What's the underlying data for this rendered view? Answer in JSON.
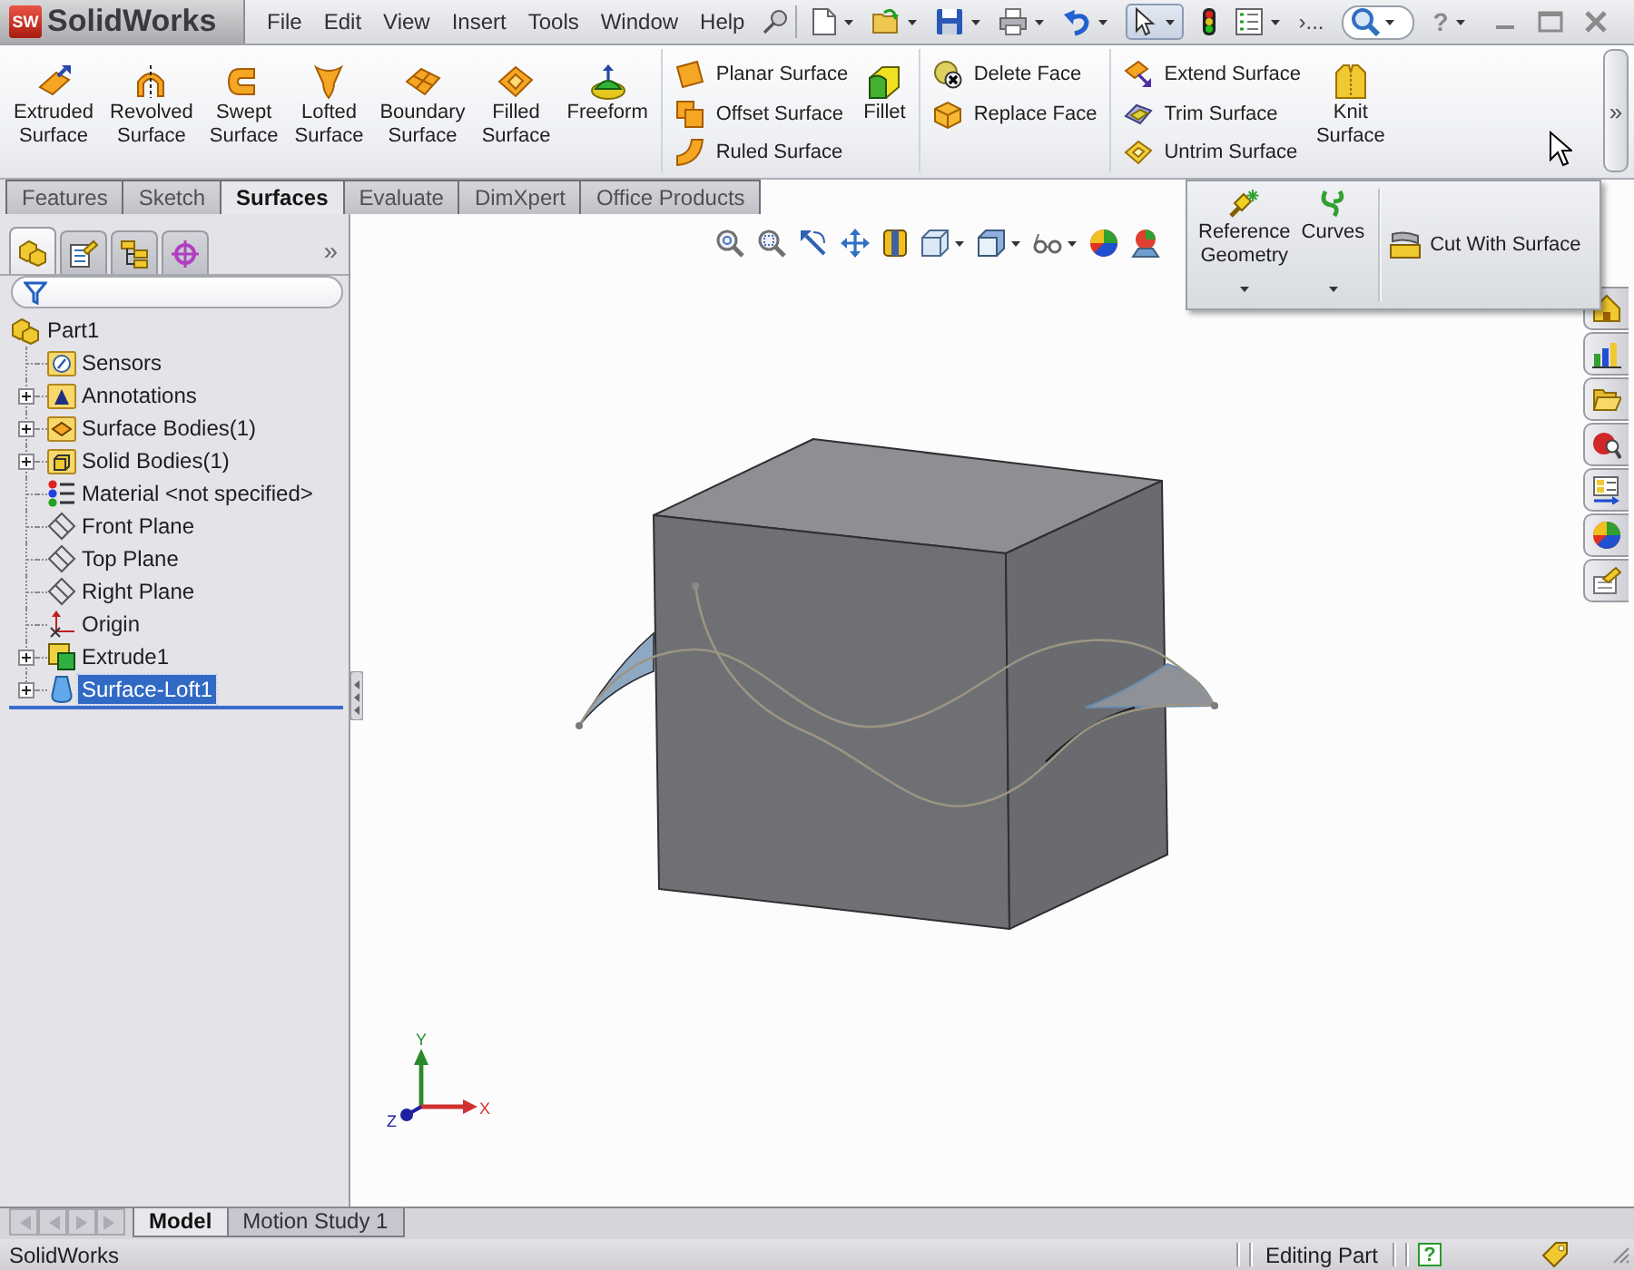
{
  "title_bar": {
    "logo_mark": "SW",
    "logo_text": "SolidWorks",
    "menu": [
      "File",
      "Edit",
      "View",
      "Insert",
      "Tools",
      "Window",
      "Help"
    ],
    "select_active": true,
    "overflow": "›...",
    "help": "?"
  },
  "ribbon": {
    "sections": [
      [
        {
          "kind": "large",
          "label": "Extruded Surface"
        },
        {
          "kind": "large",
          "label": "Revolved Surface"
        },
        {
          "kind": "large",
          "label": "Swept Surface"
        },
        {
          "kind": "large",
          "label": "Lofted Surface"
        },
        {
          "kind": "large",
          "label": "Boundary Surface"
        },
        {
          "kind": "large",
          "label": "Filled Surface"
        },
        {
          "kind": "large",
          "label": "Freeform"
        }
      ],
      [
        {
          "kind": "stack",
          "items": [
            "Planar Surface",
            "Offset Surface",
            "Ruled Surface"
          ]
        },
        {
          "kind": "large",
          "label": "Fillet"
        }
      ],
      [
        {
          "kind": "stack",
          "items": [
            "Delete Face",
            "Replace Face"
          ]
        }
      ],
      [
        {
          "kind": "stack",
          "items": [
            "Extend Surface",
            "Trim Surface",
            "Untrim Surface"
          ]
        },
        {
          "kind": "large",
          "label": "Knit Surface"
        }
      ]
    ],
    "more": "»"
  },
  "tabs": [
    {
      "label": "Features",
      "selected": false
    },
    {
      "label": "Sketch",
      "selected": false
    },
    {
      "label": "Surfaces",
      "selected": true
    },
    {
      "label": "Evaluate",
      "selected": false
    },
    {
      "label": "DimXpert",
      "selected": false
    },
    {
      "label": "Office Products",
      "selected": false
    }
  ],
  "flyout": {
    "items": [
      {
        "kind": "large",
        "label": "Reference Geometry"
      },
      {
        "kind": "large",
        "label": "Curves"
      },
      {
        "kind": "small",
        "label": "Cut With Surface"
      }
    ]
  },
  "feature_manager": {
    "panel_tabs": [
      {
        "selected": true
      },
      {
        "selected": false
      },
      {
        "selected": false
      },
      {
        "selected": false
      }
    ],
    "more": "»",
    "tree": {
      "label": "Part1",
      "selected": false,
      "children": [
        {
          "label": "Sensors",
          "expandable": false,
          "selected": false
        },
        {
          "label": "Annotations",
          "expandable": true,
          "selected": false
        },
        {
          "label": "Surface Bodies(1)",
          "expandable": true,
          "selected": false
        },
        {
          "label": "Solid Bodies(1)",
          "expandable": true,
          "selected": false
        },
        {
          "label": "Material <not specified>",
          "expandable": false,
          "selected": false
        },
        {
          "label": "Front Plane",
          "expandable": false,
          "selected": false
        },
        {
          "label": "Top Plane",
          "expandable": false,
          "selected": false
        },
        {
          "label": "Right Plane",
          "expandable": false,
          "selected": false
        },
        {
          "label": "Origin",
          "expandable": false,
          "selected": false
        },
        {
          "label": "Extrude1",
          "expandable": true,
          "selected": false
        },
        {
          "label": "Surface-Loft1",
          "expandable": true,
          "selected": true
        }
      ]
    }
  },
  "graphics": {
    "triad": {
      "x": "X",
      "y": "Y",
      "z": "Z"
    }
  },
  "bottom_tabs": {
    "scroll_disabled": true,
    "tabs": [
      {
        "label": "Model",
        "selected": true
      },
      {
        "label": "Motion Study 1",
        "selected": false
      }
    ]
  },
  "status_bar": {
    "text": "SolidWorks",
    "mode": "Editing Part",
    "help": "?"
  }
}
